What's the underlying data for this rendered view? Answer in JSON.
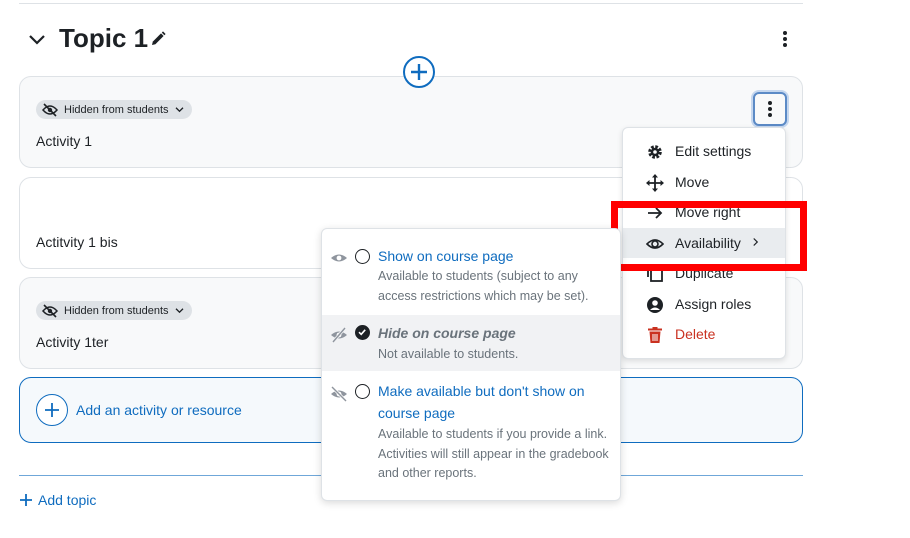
{
  "section": {
    "title": "Topic 1"
  },
  "activities": [
    {
      "name": "Activity 1",
      "badge": "Hidden from students"
    },
    {
      "name": "Actitvity 1 bis",
      "badge": ""
    },
    {
      "name": "Activity 1ter",
      "badge": "Hidden from students"
    }
  ],
  "add_activity": {
    "label": "Add an activity or resource"
  },
  "add_topic": {
    "label": "Add topic"
  },
  "action_menu": {
    "items": [
      {
        "label": "Edit settings",
        "icon": "gear-icon"
      },
      {
        "label": "Move",
        "icon": "move-arrows-icon"
      },
      {
        "label": "Move right",
        "icon": "arrow-right-icon"
      },
      {
        "label": "Availability",
        "icon": "eye-icon",
        "active": true
      },
      {
        "label": "Duplicate",
        "icon": "duplicate-icon"
      },
      {
        "label": "Assign roles",
        "icon": "user-circle-icon"
      },
      {
        "label": "Delete",
        "icon": "trash-icon",
        "danger": true
      }
    ]
  },
  "availability_menu": {
    "options": [
      {
        "title": "Show on course page",
        "description": "Available to students (subject to any access restrictions which may be set).",
        "icon": "eye-icon",
        "selected": false
      },
      {
        "title": "Hide on course page",
        "description": "Not available to students.",
        "icon": "eye-slash-icon",
        "selected": true
      },
      {
        "title": "Make available but don't show on course page",
        "description": "Available to students if you provide a link. Activities will still appear in the gradebook and other reports.",
        "icon": "stealth-icon",
        "selected": false
      }
    ]
  },
  "colors": {
    "link": "#0f6cbf",
    "danger": "#ca3120",
    "highlight": "#ff0000",
    "muted": "#6a737b"
  }
}
